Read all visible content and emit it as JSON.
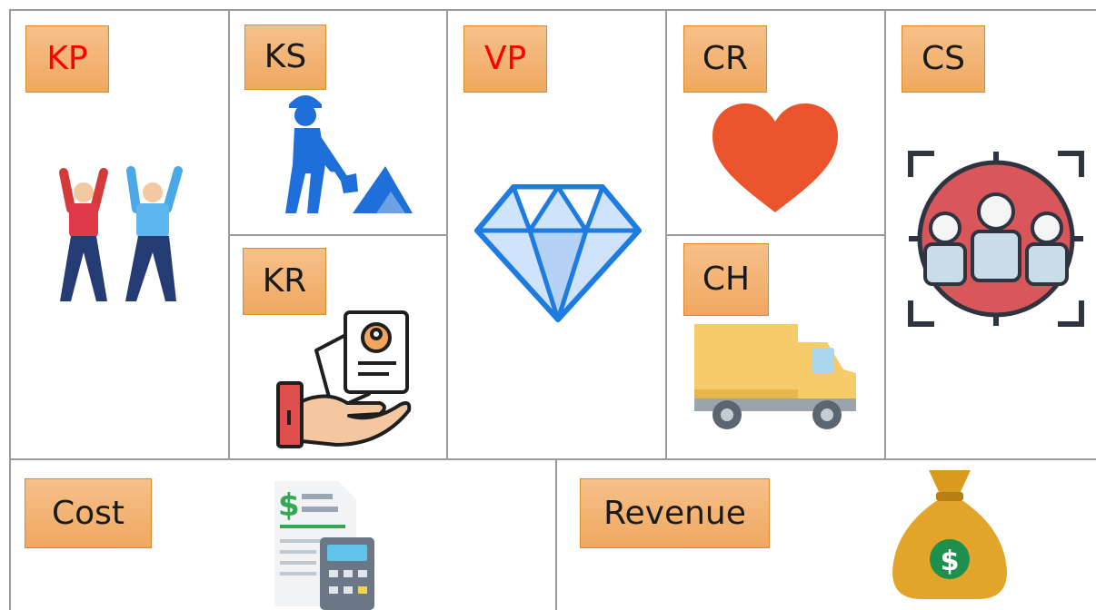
{
  "blocks": {
    "kp": {
      "label": "KP",
      "color": "#ff0000",
      "icon": "people-cheering-icon"
    },
    "ks": {
      "label": "KS",
      "color": "#1a1a1a",
      "icon": "worker-shoveling-icon"
    },
    "vp": {
      "label": "VP",
      "color": "#ff0000",
      "icon": "diamond-icon"
    },
    "cr": {
      "label": "CR",
      "color": "#1a1a1a",
      "icon": "heart-icon"
    },
    "cs": {
      "label": "CS",
      "color": "#1a1a1a",
      "icon": "target-customers-icon"
    },
    "kr": {
      "label": "KR",
      "color": "#1a1a1a",
      "icon": "resource-hand-cards-icon"
    },
    "ch": {
      "label": "CH",
      "color": "#1a1a1a",
      "icon": "delivery-truck-icon"
    },
    "cost": {
      "label": "Cost",
      "color": "#1a1a1a",
      "icon": "invoice-calculator-icon"
    },
    "revenue": {
      "label": "Revenue",
      "color": "#1a1a1a",
      "icon": "money-bag-icon"
    }
  }
}
